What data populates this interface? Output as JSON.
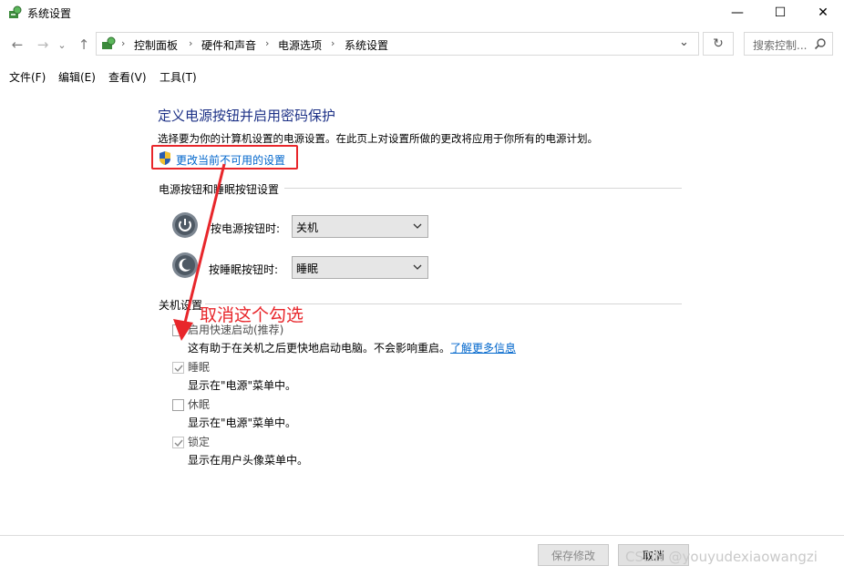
{
  "window": {
    "title": "系统设置",
    "minimize": "—",
    "maximize": "☐",
    "close": "✕"
  },
  "nav": {
    "back": "←",
    "forward": "→",
    "recent": "⌄",
    "up": "↑",
    "breadcrumb": [
      "控制面板",
      "硬件和声音",
      "电源选项",
      "系统设置"
    ],
    "separator": "›",
    "dropdown": "⌄",
    "refresh": "↻",
    "search_placeholder": "搜索控制..."
  },
  "menu": [
    {
      "label": "文件(F)"
    },
    {
      "label": "编辑(E)"
    },
    {
      "label": "查看(V)"
    },
    {
      "label": "工具(T)"
    }
  ],
  "content": {
    "title": "定义电源按钮并启用密码保护",
    "description": "选择要为你的计算机设置的电源设置。在此页上对设置所做的更改将应用于你所有的电源计划。",
    "change_link": "更改当前不可用的设置",
    "buttons_section": "电源按钮和睡眠按钮设置",
    "power_label": "按电源按钮时:",
    "power_value": "关机",
    "sleep_label": "按睡眠按钮时:",
    "sleep_value": "睡眠",
    "shutdown_section": "关机设置",
    "options": [
      {
        "label": "启用快速启动(推荐)",
        "desc": "这有助于在关机之后更快地启动电脑。不会影响重启。",
        "link": "了解更多信息",
        "checked": false
      },
      {
        "label": "睡眠",
        "desc": "显示在\"电源\"菜单中。",
        "checked": true
      },
      {
        "label": "休眠",
        "desc": "显示在\"电源\"菜单中。",
        "checked": false
      },
      {
        "label": "锁定",
        "desc": "显示在用户头像菜单中。",
        "checked": true
      }
    ]
  },
  "annotation": "取消这个勾选",
  "footer": {
    "save": "保存修改",
    "cancel": "取消"
  },
  "watermark": "CSDN @youyudexiaowangzi",
  "icons": {
    "app": "control-panel-icon",
    "shield": "uac-shield-icon",
    "power": "power-button-icon",
    "sleep": "sleep-moon-icon"
  },
  "colors": {
    "title": "#1e3287",
    "link": "#0066cc",
    "annotation": "#e8262b"
  }
}
